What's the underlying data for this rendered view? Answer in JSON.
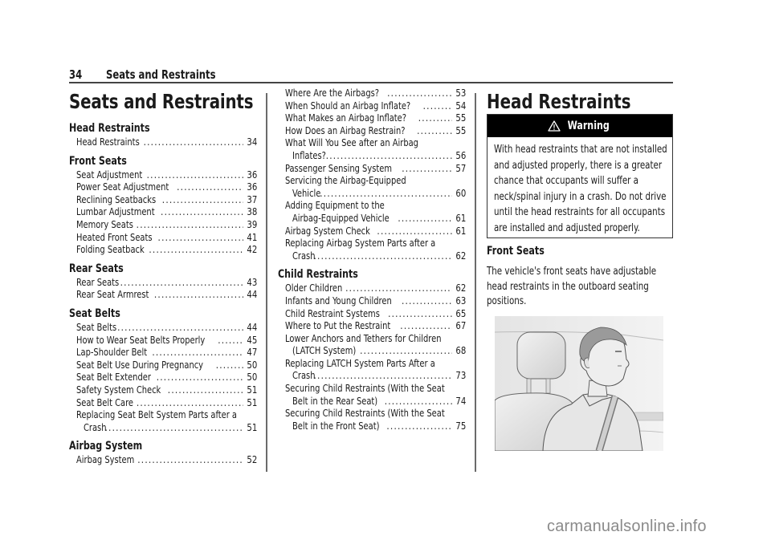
{
  "header": {
    "page_number": "34",
    "running_title": "Seats and Restraints"
  },
  "chapter_title": "Seats and Restraints",
  "toc": {
    "column1": [
      {
        "section": "Head Restraints",
        "entries": [
          {
            "title": "Head Restraints",
            "page": "34"
          }
        ]
      },
      {
        "section": "Front Seats",
        "entries": [
          {
            "title": "Seat Adjustment",
            "page": "36"
          },
          {
            "title": "Power Seat Adjustment",
            "page": "36"
          },
          {
            "title": "Reclining Seatbacks",
            "page": "37"
          },
          {
            "title": "Lumbar Adjustment",
            "page": "38"
          },
          {
            "title": "Memory Seats",
            "page": "39"
          },
          {
            "title": "Heated Front Seats",
            "page": "41"
          },
          {
            "title": "Folding Seatback",
            "page": "42"
          }
        ]
      },
      {
        "section": "Rear Seats",
        "entries": [
          {
            "title": "Rear Seats",
            "page": "43"
          },
          {
            "title": "Rear Seat Armrest",
            "page": "44"
          }
        ]
      },
      {
        "section": "Seat Belts",
        "entries": [
          {
            "title": "Seat Belts",
            "page": "44"
          },
          {
            "title": "How to Wear Seat Belts Properly",
            "page": "45"
          },
          {
            "title": "Lap-Shoulder Belt",
            "page": "47"
          },
          {
            "title": "Seat Belt Use During Pregnancy",
            "page": "50"
          },
          {
            "title": "Seat Belt Extender",
            "page": "50"
          },
          {
            "title": "Safety System Check",
            "page": "51"
          },
          {
            "title": "Seat Belt Care",
            "page": "51"
          },
          {
            "title": "Replacing Seat Belt System Parts after a",
            "title_cont": "Crash",
            "page": "51"
          }
        ]
      },
      {
        "section": "Airbag System",
        "entries": [
          {
            "title": "Airbag System",
            "page": "52"
          }
        ]
      }
    ],
    "column2": [
      {
        "section": "",
        "entries": [
          {
            "title": "Where Are the Airbags?",
            "page": "53"
          },
          {
            "title": "When Should an Airbag Inflate?",
            "page": "54"
          },
          {
            "title": "What Makes an Airbag Inflate?",
            "page": "55"
          },
          {
            "title": "How Does an Airbag Restrain?",
            "page": "55"
          },
          {
            "title": "What Will You See after an Airbag",
            "title_cont": "Inflates?",
            "page": "56"
          },
          {
            "title": "Passenger Sensing System",
            "page": "57"
          },
          {
            "title": "Servicing the Airbag-Equipped",
            "title_cont": "Vehicle",
            "page": "60"
          },
          {
            "title": "Adding Equipment to the",
            "title_cont": "Airbag-Equipped Vehicle",
            "page": "61"
          },
          {
            "title": "Airbag System Check",
            "page": "61"
          },
          {
            "title": "Replacing Airbag System Parts after a",
            "title_cont": "Crash",
            "page": "62"
          }
        ]
      },
      {
        "section": "Child Restraints",
        "entries": [
          {
            "title": "Older Children",
            "page": "62"
          },
          {
            "title": "Infants and Young Children",
            "page": "63"
          },
          {
            "title": "Child Restraint Systems",
            "page": "65"
          },
          {
            "title": "Where to Put the Restraint",
            "page": "67"
          },
          {
            "title": "Lower Anchors and Tethers for Children",
            "title_cont": "(LATCH System)",
            "page": "68"
          },
          {
            "title": "Replacing LATCH System Parts After a",
            "title_cont": "Crash",
            "page": "73"
          },
          {
            "title": "Securing Child Restraints (With the Seat",
            "title_cont": "Belt in the Rear Seat)",
            "page": "74"
          },
          {
            "title": "Securing Child Restraints (With the Seat",
            "title_cont": "Belt in the Front Seat)",
            "page": "75"
          }
        ]
      }
    ]
  },
  "section": {
    "title": "Head Restraints",
    "warning": {
      "icon": "warning-triangle-icon",
      "label": "Warning",
      "text": "With head restraints that are not installed and adjusted properly, there is a greater chance that occupants will suffer a neck/spinal injury in a crash. Do not drive until the head restraints for all occupants are installed and adjusted properly."
    },
    "subsection_title": "Front Seats",
    "paragraph": "The vehicle's front seats have adjustable head restraints in the outboard seating positions.",
    "illustration": "driver-with-head-restraint-illustration"
  },
  "watermark": "carmanualsonline.info"
}
